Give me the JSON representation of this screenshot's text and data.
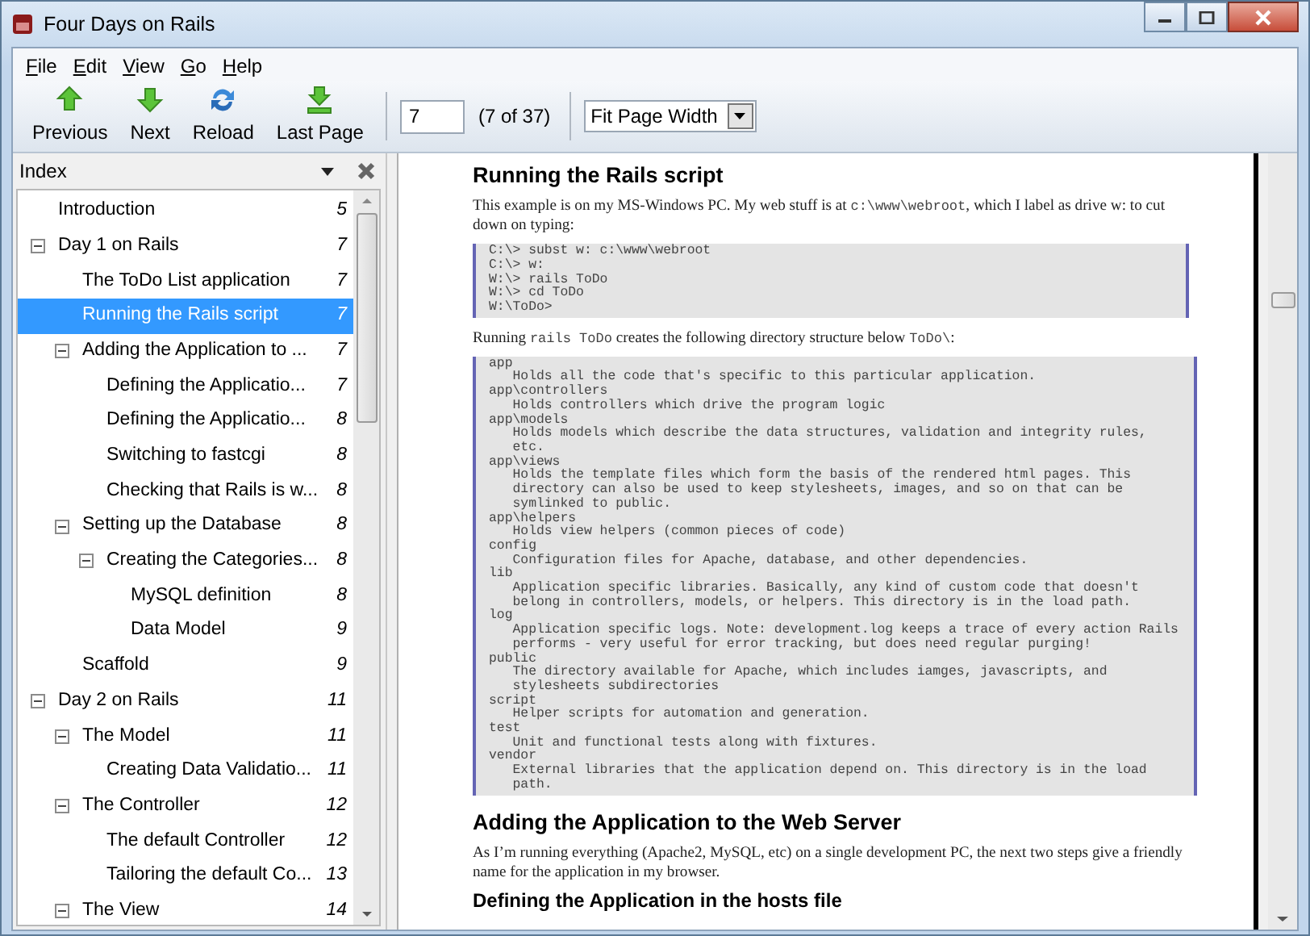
{
  "window": {
    "title": "Four Days on Rails"
  },
  "menu": [
    "File",
    "Edit",
    "View",
    "Go",
    "Help"
  ],
  "toolbar": {
    "buttons": [
      {
        "label": "Previous",
        "kind": "previous"
      },
      {
        "label": "Next",
        "kind": "next"
      },
      {
        "label": "Reload",
        "kind": "reload"
      },
      {
        "label": "Last Page",
        "kind": "last"
      }
    ],
    "page_field": {
      "value": "7"
    },
    "page_count": "(7 of 37)",
    "zoom_select": {
      "value": "Fit Page Width"
    }
  },
  "index_panel": {
    "title": "Index",
    "items": [
      {
        "text": "Introduction",
        "page": "5",
        "selected": false
      },
      {
        "text": "Day 1 on Rails",
        "page": "7",
        "selected": false,
        "expanded": true,
        "children": [
          {
            "text": "The ToDo List application",
            "page": "7",
            "selected": false
          },
          {
            "text": "Running the Rails script",
            "page": "7",
            "selected": true
          },
          {
            "text": "Adding the Application to ...",
            "page": "7",
            "selected": false,
            "expanded": true,
            "children": [
              {
                "text": "Defining the Applicatio...",
                "page": "7",
                "selected": false
              },
              {
                "text": "Defining the Applicatio...",
                "page": "8",
                "selected": false
              },
              {
                "text": "Switching to fastcgi",
                "page": "8",
                "selected": false
              },
              {
                "text": "Checking that Rails is w...",
                "page": "8",
                "selected": false
              }
            ]
          },
          {
            "text": "Setting up the Database",
            "page": "8",
            "selected": false,
            "expanded": true,
            "children": [
              {
                "text": "Creating the Categories...",
                "page": "8",
                "selected": false,
                "expanded": true,
                "children": [
                  {
                    "text": "MySQL definition",
                    "page": "8",
                    "selected": false
                  },
                  {
                    "text": "Data Model",
                    "page": "9",
                    "selected": false
                  }
                ]
              }
            ]
          },
          {
            "text": "Scaffold",
            "page": "9",
            "selected": false
          }
        ]
      },
      {
        "text": "Day 2 on Rails",
        "page": "11",
        "selected": false,
        "expanded": true,
        "children": [
          {
            "text": "The Model",
            "page": "11",
            "selected": false,
            "expanded": true,
            "children": [
              {
                "text": "Creating Data Validatio...",
                "page": "11",
                "selected": false
              }
            ]
          },
          {
            "text": "The Controller",
            "page": "12",
            "selected": false,
            "expanded": true,
            "children": [
              {
                "text": "The default Controller",
                "page": "12",
                "selected": false
              },
              {
                "text": "Tailoring the default Co...",
                "page": "13",
                "selected": false
              }
            ]
          },
          {
            "text": "The View",
            "page": "14",
            "selected": false,
            "expanded": true
          }
        ]
      }
    ]
  },
  "document": {
    "blocks": [
      {
        "kind": "heading",
        "text": "Running the Rails script"
      },
      {
        "kind": "paragraph",
        "parts": [
          {
            "kind": "text",
            "text": "This example is on my MS-Windows PC. My web stuff is at "
          },
          {
            "kind": "code",
            "text": "c:\\www\\webroot"
          },
          {
            "kind": "text",
            "text": ", which I label as drive w: to cut down on typing:"
          }
        ]
      },
      {
        "kind": "code",
        "lines": [
          "C:\\> subst w: c:\\www\\webroot",
          "C:\\> w:",
          "W:\\> rails ToDo",
          "W:\\> cd ToDo",
          "W:\\ToDo>"
        ]
      },
      {
        "kind": "paragraph",
        "parts": [
          {
            "kind": "text",
            "text": "Running "
          },
          {
            "kind": "code",
            "text": "rails ToDo"
          },
          {
            "kind": "text",
            "text": " creates the following directory structure below "
          },
          {
            "kind": "code",
            "text": "ToDo\\"
          },
          {
            "kind": "text",
            "text": ":"
          }
        ]
      },
      {
        "kind": "code",
        "lines": [
          "app",
          "   Holds all the code that's specific to this particular application.",
          "app\\controllers",
          "   Holds controllers which drive the program logic",
          "app\\models",
          "   Holds models which describe the data structures, validation and integrity rules,",
          "   etc.",
          "app\\views",
          "   Holds the template files which form the basis of the rendered html pages. This",
          "   directory can also be used to keep stylesheets, images, and so on that can be",
          "   symlinked to public.",
          "app\\helpers",
          "   Holds view helpers (common pieces of code)",
          "config",
          "   Configuration files for Apache, database, and other dependencies.",
          "lib",
          "   Application specific libraries. Basically, any kind of custom code that doesn't",
          "   belong in controllers, models, or helpers. This directory is in the load path.",
          "log",
          "   Application specific logs. Note: development.log keeps a trace of every action Rails",
          "   performs - very useful for error tracking, but does need regular purging!",
          "public",
          "   The directory available for Apache, which includes iamges, javascripts, and",
          "   stylesheets subdirectories",
          "script",
          "   Helper scripts for automation and generation.",
          "test",
          "   Unit and functional tests along with fixtures.",
          "vendor",
          "   External libraries that the application depend on. This directory is in the load",
          "   path."
        ]
      },
      {
        "kind": "heading",
        "text": "Adding the Application to the Web Server"
      },
      {
        "kind": "paragraph",
        "parts": [
          {
            "kind": "text",
            "text": "As I’m running everything (Apache2, MySQL, etc) on a single development PC, the next two steps give a friendly name for the application in my browser."
          }
        ]
      },
      {
        "kind": "subheading",
        "text": "Defining the Application in the hosts file"
      }
    ]
  }
}
